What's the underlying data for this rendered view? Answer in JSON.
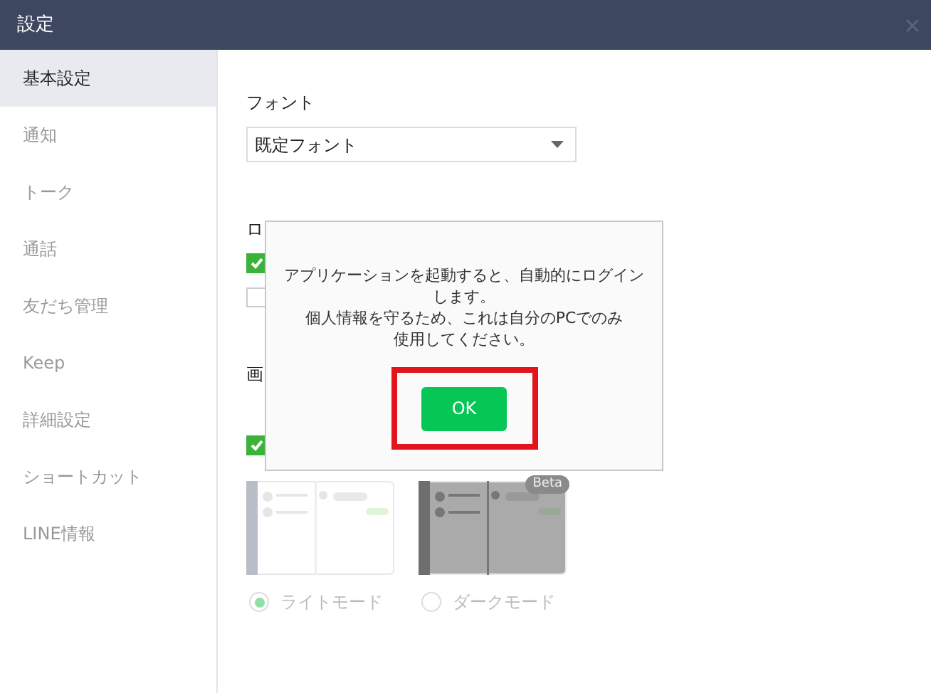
{
  "window": {
    "title": "設定"
  },
  "sidebar": {
    "items": [
      {
        "label": "基本設定",
        "selected": true
      },
      {
        "label": "通知",
        "selected": false
      },
      {
        "label": "トーク",
        "selected": false
      },
      {
        "label": "通話",
        "selected": false
      },
      {
        "label": "友だち管理",
        "selected": false
      },
      {
        "label": "Keep",
        "selected": false
      },
      {
        "label": "詳細設定",
        "selected": false
      },
      {
        "label": "ショートカット",
        "selected": false
      },
      {
        "label": "LINE情報",
        "selected": false
      }
    ]
  },
  "settings": {
    "font": {
      "label": "フォント",
      "value": "既定フォント"
    },
    "login": {
      "label": "ロ",
      "checkboxes": [
        {
          "checked": true
        },
        {
          "checked": false
        }
      ]
    },
    "display": {
      "label": "画",
      "checkboxes": [
        {
          "checked": true
        }
      ],
      "themes": [
        {
          "kind": "light",
          "label": "ライトモード",
          "selected": true
        },
        {
          "kind": "dark",
          "label": "ダークモード",
          "selected": false,
          "badge": "Beta"
        }
      ]
    }
  },
  "dialog": {
    "message_lines": [
      "アプリケーションを起動すると、自動的にログイン",
      "します。",
      "個人情報を守るため、これは自分のPCでのみ",
      "使用してください。"
    ],
    "ok_button": "OK",
    "highlighted": true
  }
}
